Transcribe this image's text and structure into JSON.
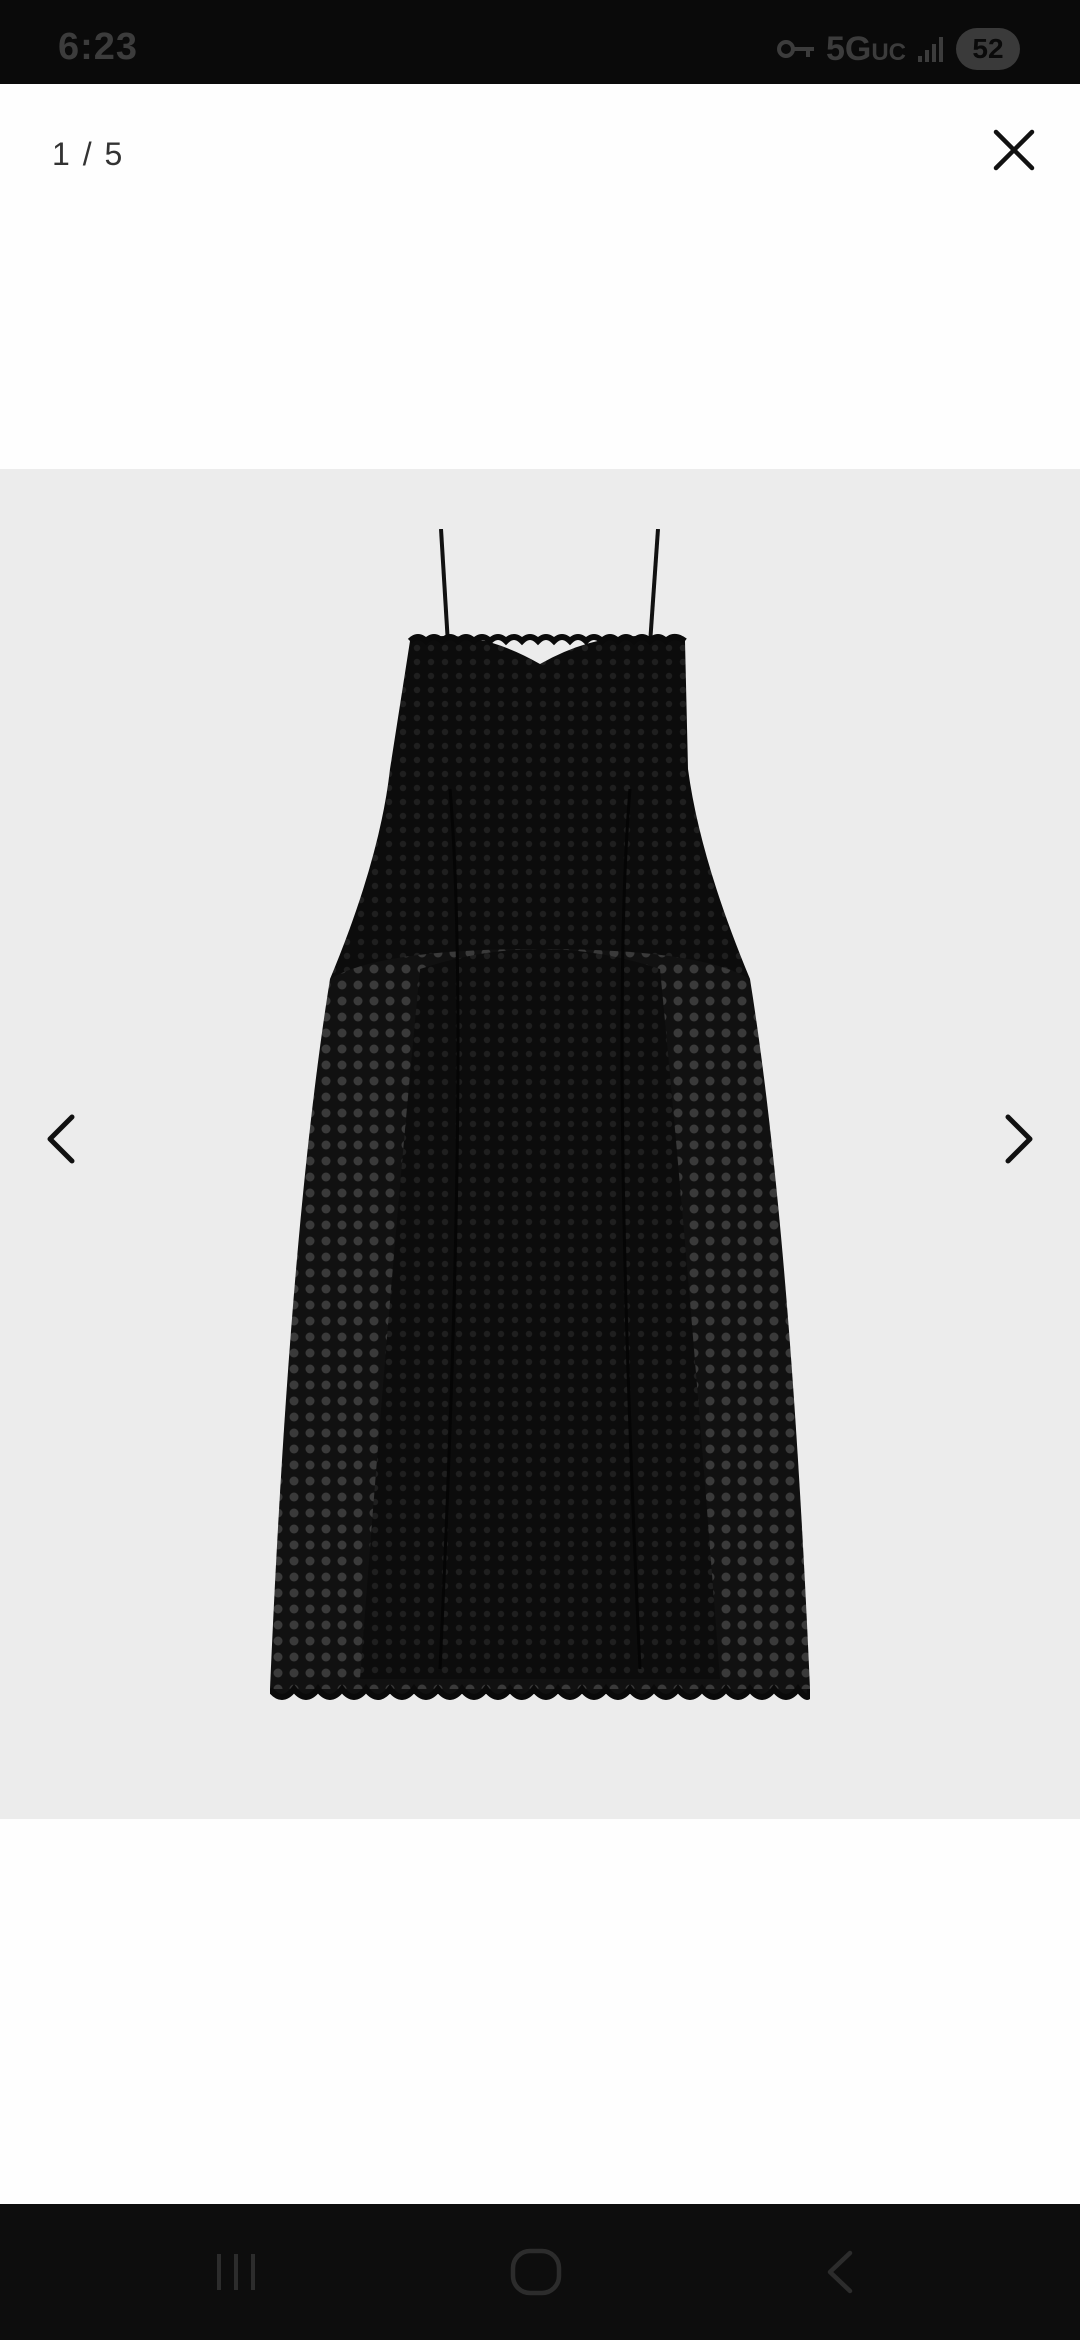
{
  "status_bar": {
    "time": "6:23",
    "network": "5G",
    "network_suffix": "UC",
    "battery": "52"
  },
  "viewer": {
    "counter": "1 / 5",
    "current_index": 1,
    "total_images": 5
  },
  "colors": {
    "status_bar_bg": "#0a0a0a",
    "viewer_bg": "#fefefe",
    "photo_bg": "#ececec",
    "garment": "#0f0f0f",
    "nav_bar_bg": "#0d0d0d"
  },
  "icons": {
    "close": "close-icon",
    "prev": "chevron-left-icon",
    "next": "chevron-right-icon",
    "recents": "recents-icon",
    "home": "home-icon",
    "back": "back-icon"
  }
}
